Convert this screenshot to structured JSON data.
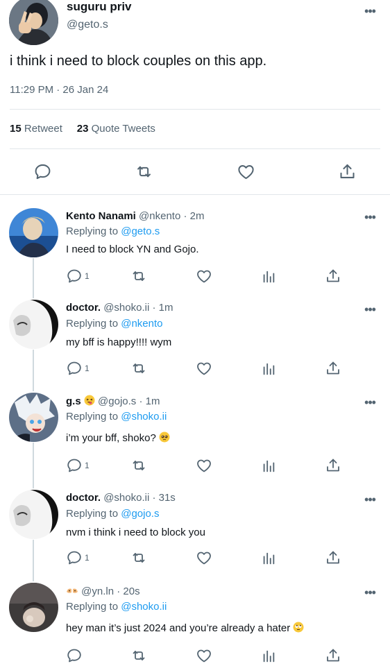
{
  "tweet": {
    "name": "suguru priv",
    "handle": "@geto.s",
    "text": "i think i need to block couples on this app.",
    "time": "11:29 PM · 26 Jan 24",
    "retweets": "15",
    "retweets_label": "Retweet",
    "quotes": "23",
    "quotes_label": "Quote Tweets"
  },
  "replies": [
    {
      "name": "Kento Nanami",
      "meta": "@nkento · 2m",
      "replying_label": "Replying to",
      "replying_to": "@geto.s",
      "text": "I need to block YN and Gojo.",
      "reply_count": "1"
    },
    {
      "name": "doctor.",
      "meta": "@shoko.ii · 1m",
      "replying_label": "Replying to",
      "replying_to": "@nkento",
      "text": "my bff is happy!!!! wym",
      "reply_count": "1"
    },
    {
      "name": "g.s",
      "meta": "@gojo.s · 1m",
      "replying_label": "Replying to",
      "replying_to": "@shoko.ii",
      "text": "i’m your bff, shoko?",
      "reply_count": "1"
    },
    {
      "name": "doctor.",
      "meta": "@shoko.ii · 31s",
      "replying_label": "Replying to",
      "replying_to": "@gojo.s",
      "text": "nvm i think i need to block you",
      "reply_count": "1"
    },
    {
      "name": "",
      "meta": "@yn.ln · 20s",
      "replying_label": "Replying to",
      "replying_to": "@shoko.ii",
      "text": "hey man it’s just 2024 and you’re already a hater",
      "reply_count": ""
    }
  ],
  "colors": {
    "accent": "#1d9bf0",
    "secondary_text": "#536471",
    "primary_text": "#0f1419",
    "divider": "#e1e6ea"
  },
  "icons": [
    "more-icon",
    "reply-icon",
    "retweet-icon",
    "like-icon",
    "share-icon",
    "analytics-icon"
  ]
}
